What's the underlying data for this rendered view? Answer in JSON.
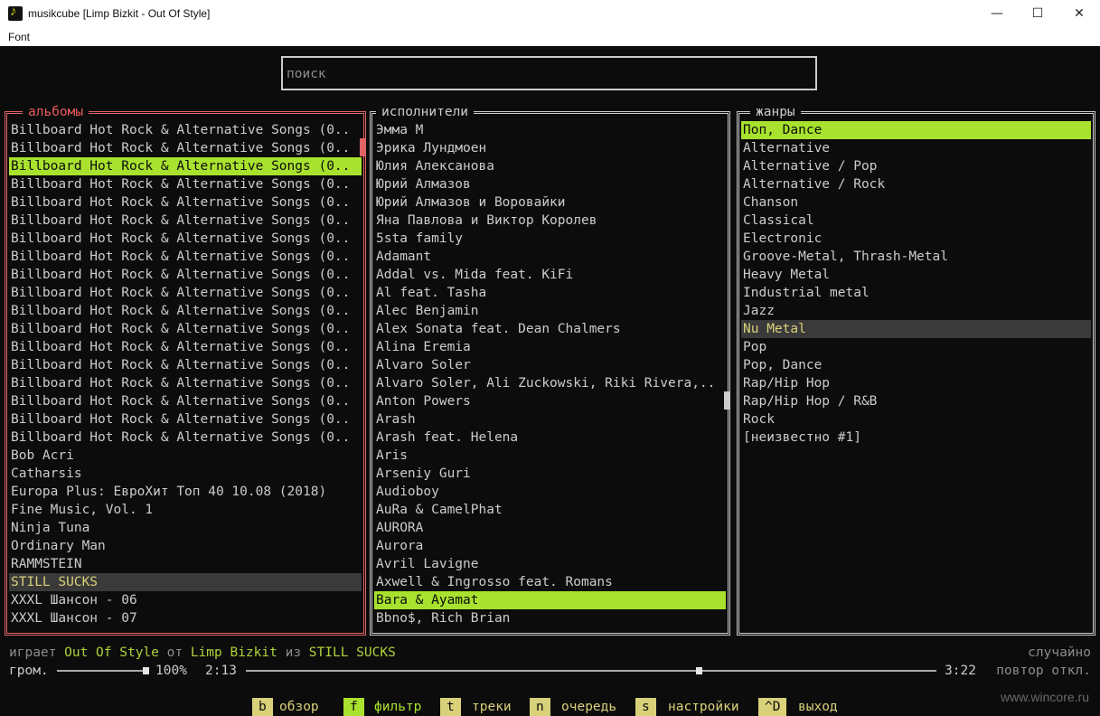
{
  "window": {
    "title": "musikcube [Limp Bizkit - Out Of Style]",
    "minimize": "—",
    "maximize": "☐",
    "close": "✕"
  },
  "menu": {
    "font": "Font"
  },
  "search": {
    "placeholder": "поиск"
  },
  "albums": {
    "title": "альбомы",
    "rows": [
      "Billboard Hot Rock & Alternative Songs (0..",
      "Billboard Hot Rock & Alternative Songs (0..",
      "Billboard Hot Rock & Alternative Songs (0..",
      "Billboard Hot Rock & Alternative Songs (0..",
      "Billboard Hot Rock & Alternative Songs (0..",
      "Billboard Hot Rock & Alternative Songs (0..",
      "Billboard Hot Rock & Alternative Songs (0..",
      "Billboard Hot Rock & Alternative Songs (0..",
      "Billboard Hot Rock & Alternative Songs (0..",
      "Billboard Hot Rock & Alternative Songs (0..",
      "Billboard Hot Rock & Alternative Songs (0..",
      "Billboard Hot Rock & Alternative Songs (0..",
      "Billboard Hot Rock & Alternative Songs (0..",
      "Billboard Hot Rock & Alternative Songs (0..",
      "Billboard Hot Rock & Alternative Songs (0..",
      "Billboard Hot Rock & Alternative Songs (0..",
      "Billboard Hot Rock & Alternative Songs (0..",
      "Billboard Hot Rock & Alternative Songs (0..",
      "Bob Acri",
      "Catharsis",
      "Europa Plus: ЕвроХит Топ 40 10.08 (2018)",
      "Fine Music, Vol. 1",
      "Ninja Tuna",
      "Ordinary Man",
      "RAMMSTEIN",
      "STILL SUCKS",
      "XXXL Шансон - 06",
      "XXXL Шансон - 07"
    ]
  },
  "artists": {
    "title": "исполнители",
    "rows": [
      "Эмма М",
      "Эрика Лундмоен",
      "Юлия Алексанова",
      "Юрий Алмазов",
      "Юрий Алмазов и Воровайки",
      "Яна Павлова и Виктор Королев",
      "5sta family",
      "Adamant",
      "Addal vs. Mida feat. KiFi",
      "Al feat. Tasha",
      "Alec Benjamin",
      "Alex Sonata feat. Dean Chalmers",
      "Alina Eremia",
      "Alvaro Soler",
      "Alvaro Soler, Ali Zuckowski, Riki Rivera,..",
      "Anton Powers",
      "Arash",
      "Arash feat. Helena",
      "Aris",
      "Arseniy Guri",
      "Audioboy",
      "AuRa & CamelPhat",
      "AURORA",
      "Aurora",
      "Avril Lavigne",
      "Axwell & Ingrosso feat. Romans",
      "Bara & Ayamat",
      "Bbno$, Rich Brian"
    ]
  },
  "genres": {
    "title": "жанры",
    "rows": [
      "Поп, Dance",
      "Alternative",
      "Alternative / Pop",
      "Alternative / Rock",
      "Chanson",
      "Classical",
      "Electronic",
      "Groove-Metal, Thrash-Metal",
      "Heavy Metal",
      "Industrial metal",
      "Jazz",
      "Nu Metal",
      "Pop",
      "Pop, Dance",
      "Rap/Hip Hop",
      "Rap/Hip Hop / R&B",
      "Rock",
      "[неизвестно #1]"
    ]
  },
  "now_playing": {
    "playing_label": "играет",
    "track": "Out Of Style",
    "by_label": "от",
    "artist": "Limp Bizkit",
    "from_label": "из",
    "album": "STILL SUCKS"
  },
  "playback": {
    "volume_label": "гром.",
    "volume": "100%",
    "volume_fraction": 1.0,
    "elapsed": "2:13",
    "duration": "3:22",
    "progress_fraction": 0.658,
    "shuffle": "случайно",
    "repeat": "повтор откл."
  },
  "footer": [
    {
      "key": "b",
      "label": "обзор"
    },
    {
      "key": "f",
      "label": "фильтр"
    },
    {
      "key": "t",
      "label": "треки"
    },
    {
      "key": "n",
      "label": "очередь"
    },
    {
      "key": "s",
      "label": "настройки"
    },
    {
      "key": "^D",
      "label": "выход"
    }
  ],
  "colors": {
    "accent_green": "#a8e22e",
    "accent_yellow": "#d9d07a",
    "albums_border": "#e06464"
  },
  "watermark": "www.wincore.ru"
}
